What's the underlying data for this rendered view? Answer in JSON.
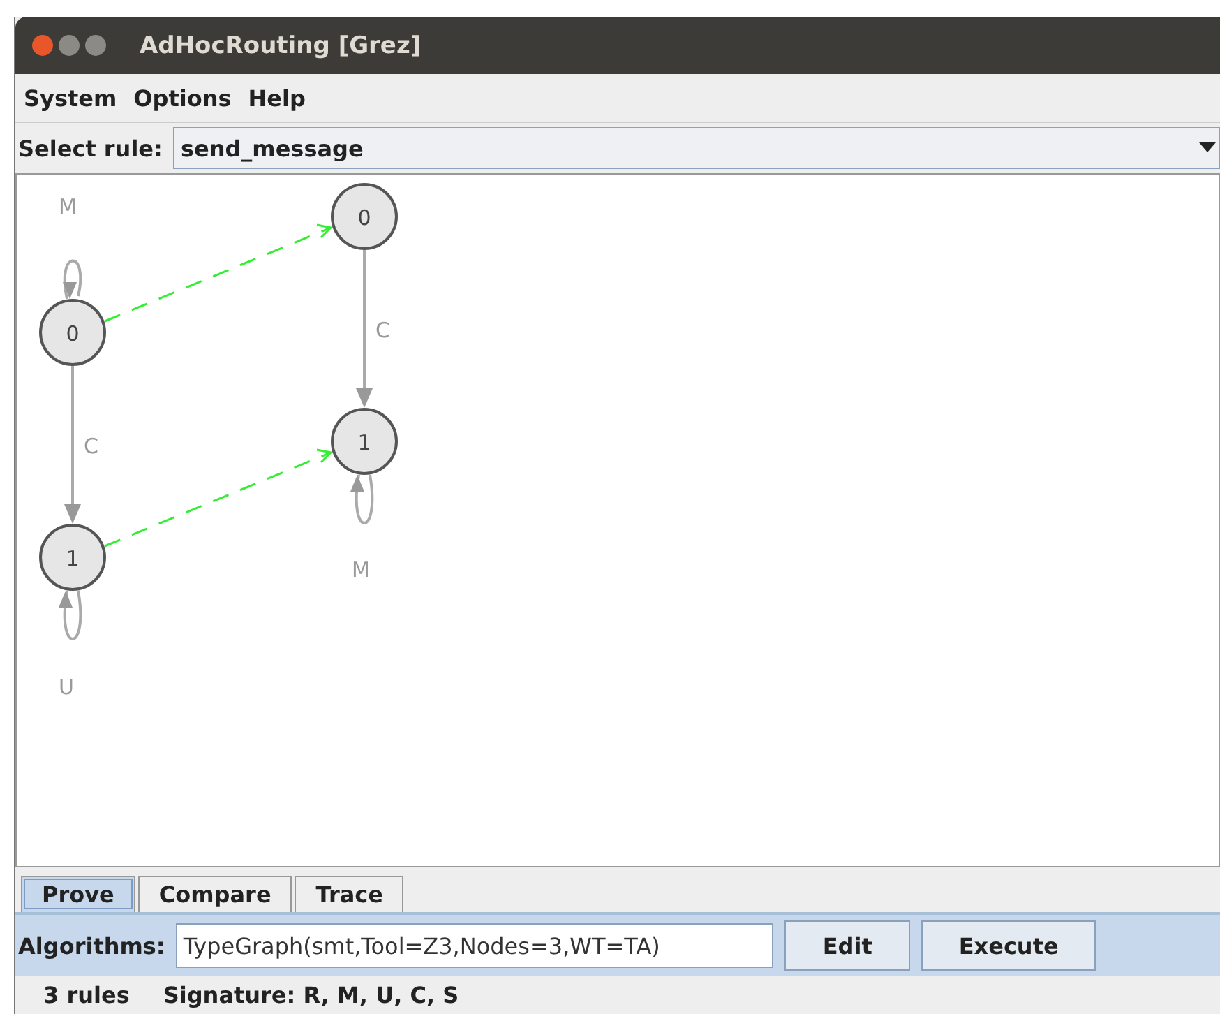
{
  "window": {
    "title": "AdHocRouting [Grez]"
  },
  "menu": [
    "System",
    "Options",
    "Help"
  ],
  "rule_select": {
    "label": "Select rule:",
    "value": "send_message"
  },
  "graph": {
    "nodes": [
      "0",
      "1",
      "0",
      "1"
    ],
    "edges": [
      {
        "kind": "loop",
        "label": "M"
      },
      {
        "kind": "edge",
        "label": "C"
      },
      {
        "kind": "loop",
        "label": "U"
      },
      {
        "kind": "edge",
        "label": "C"
      },
      {
        "kind": "loop",
        "label": "M"
      },
      {
        "kind": "mapping"
      },
      {
        "kind": "mapping"
      }
    ]
  },
  "tabs": [
    {
      "label": "Prove",
      "selected": true
    },
    {
      "label": "Compare",
      "selected": false
    },
    {
      "label": "Trace",
      "selected": false
    }
  ],
  "algorithms": {
    "label": "Algorithms:",
    "value": "TypeGraph(smt,Tool=Z3,Nodes=3,WT=TA)"
  },
  "buttons": [
    "Edit",
    "Execute"
  ],
  "status_bar": {
    "rules": "3 rules",
    "signature": "Signature: R, M, U, C, S"
  }
}
